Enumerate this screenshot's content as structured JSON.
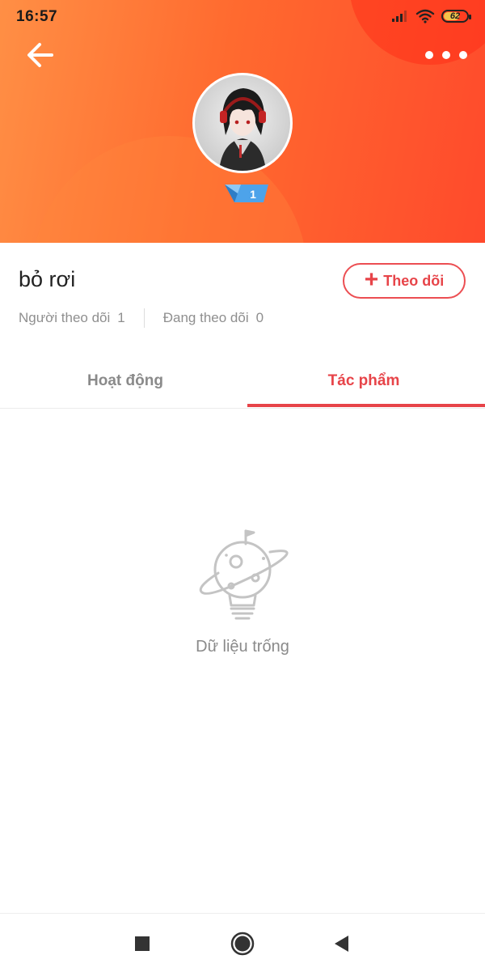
{
  "status_bar": {
    "time": "16:57",
    "battery_level": "62",
    "battery_fraction": 0.62,
    "icons": [
      "signal-icon",
      "wifi-icon",
      "battery-icon"
    ]
  },
  "header": {
    "gradient_colors": [
      "#ff8f45",
      "#ff6a2f",
      "#ff4a2c"
    ],
    "icons": [
      "back-arrow-icon",
      "more-options-icon"
    ],
    "level": "1"
  },
  "profile": {
    "username": "bỏ rơi",
    "follow_button": "Theo dõi",
    "followers_label": "Người theo dõi",
    "followers_count": "1",
    "following_label": "Đang theo dõi",
    "following_count": "0"
  },
  "tabs": [
    {
      "label": "Hoạt động",
      "active": false
    },
    {
      "label": "Tác phẩm",
      "active": true
    }
  ],
  "empty_state": {
    "icon": "planet-bulb-icon",
    "text": "Dữ liệu trống"
  },
  "accent_color": "#e74449",
  "nav_bar": {
    "icons": [
      "square-recents-icon",
      "circle-home-icon",
      "triangle-back-icon"
    ]
  }
}
